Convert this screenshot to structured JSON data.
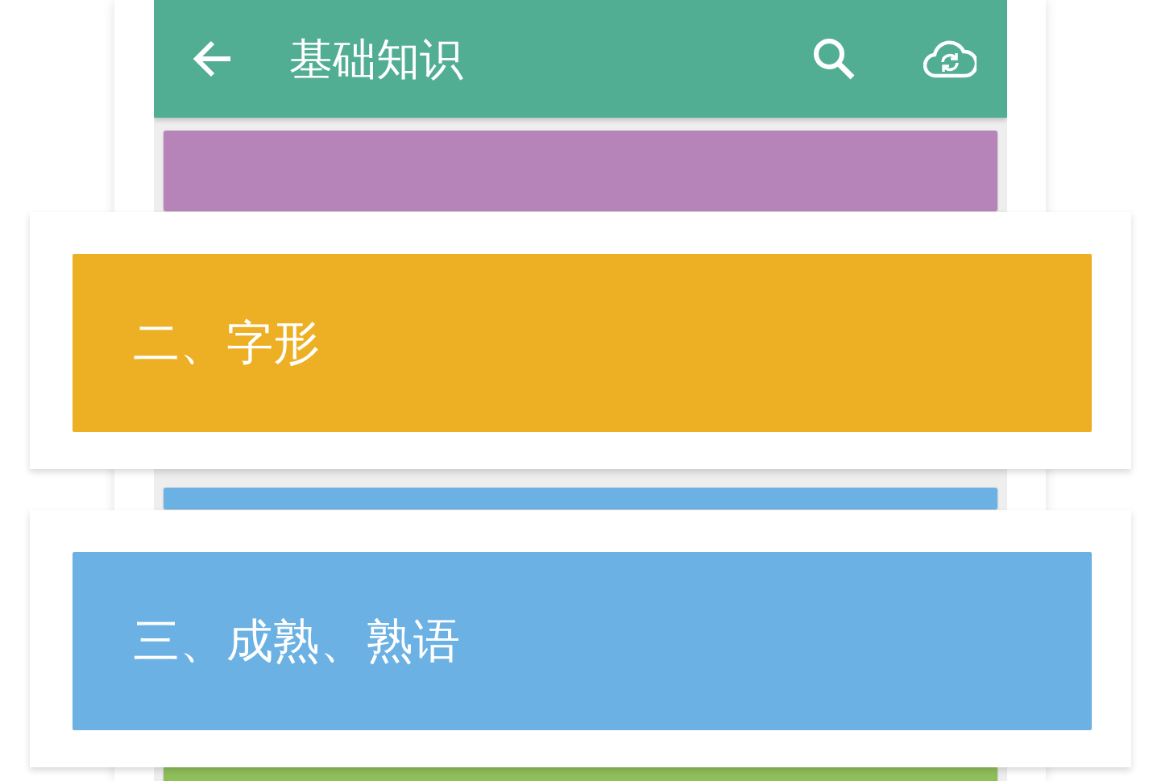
{
  "app_bar": {
    "title": "基础知识"
  },
  "list": [
    {
      "color": "#b784ba"
    },
    {
      "color": "#6cb1e3"
    },
    {
      "color": "#8fbf5a"
    }
  ],
  "zoomed_cards": [
    {
      "title": "二、字形",
      "color": "#edaf24"
    },
    {
      "title": "三、成熟、熟语",
      "color": "#6cb1e3"
    }
  ]
}
